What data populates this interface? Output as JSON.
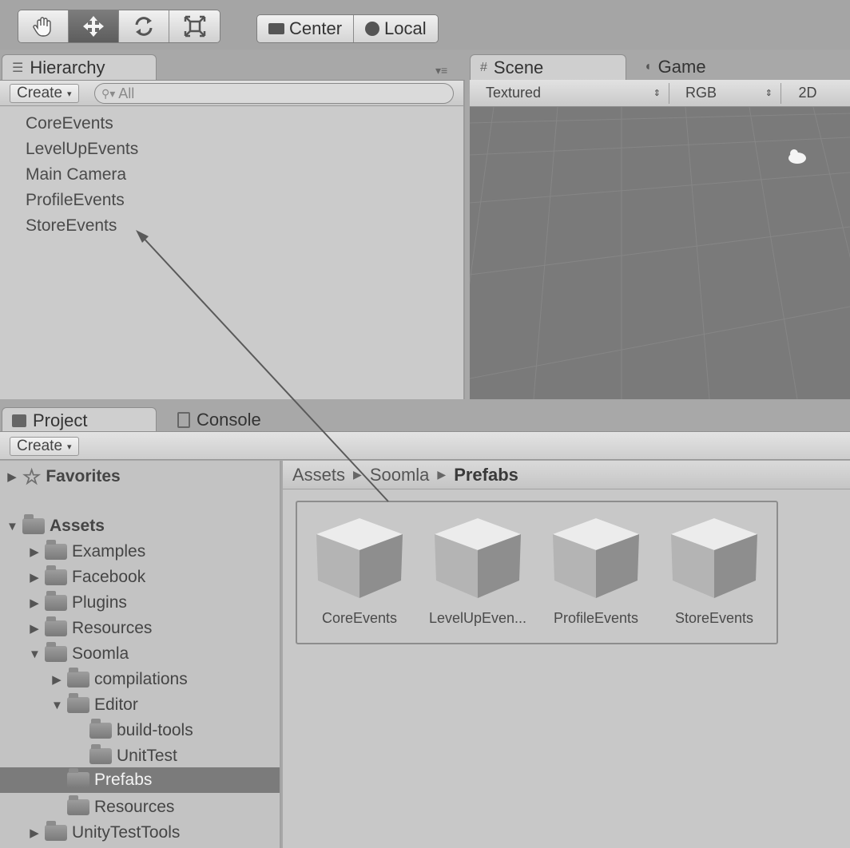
{
  "toolbar": {
    "tools": [
      {
        "name": "hand-tool",
        "icon": "hand-icon"
      },
      {
        "name": "move-tool",
        "icon": "move-icon",
        "active": true
      },
      {
        "name": "rotate-tool",
        "icon": "rotate-icon"
      },
      {
        "name": "scale-tool",
        "icon": "scale-icon"
      }
    ],
    "pivot_label": "Center",
    "space_label": "Local"
  },
  "hierarchy": {
    "tab_label": "Hierarchy",
    "create_label": "Create",
    "search_placeholder": "All",
    "items": [
      "CoreEvents",
      "LevelUpEvents",
      "Main Camera",
      "ProfileEvents",
      "StoreEvents"
    ]
  },
  "scene": {
    "tab_label": "Scene",
    "game_tab_label": "Game",
    "shading_mode": "Textured",
    "render_mode": "RGB",
    "mode_2d": "2D"
  },
  "project": {
    "tab_label": "Project",
    "console_tab_label": "Console",
    "create_label": "Create",
    "tree": {
      "favorites": "Favorites",
      "assets": "Assets",
      "examples": "Examples",
      "facebook": "Facebook",
      "plugins": "Plugins",
      "resources": "Resources",
      "soomla": "Soomla",
      "compilations": "compilations",
      "editor": "Editor",
      "build_tools": "build-tools",
      "unit_test": "UnitTest",
      "prefabs": "Prefabs",
      "soomla_resources": "Resources",
      "unity_test_tools": "UnityTestTools"
    },
    "breadcrumb": [
      "Assets",
      "Soomla",
      "Prefabs"
    ],
    "assets": [
      "CoreEvents",
      "LevelUpEven...",
      "ProfileEvents",
      "StoreEvents"
    ]
  },
  "colors": {
    "selection": "#7b7b7b",
    "scene_background": "#7a7a7a"
  }
}
